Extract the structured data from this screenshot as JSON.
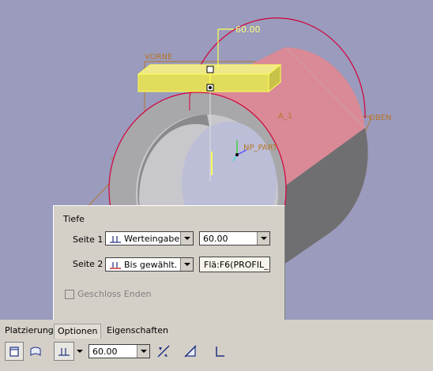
{
  "viewport": {
    "labels": {
      "front_plane": "VORNE",
      "top_plane": "OBEN",
      "axis": "A_1",
      "csys": "NP_PART"
    },
    "dimension_value": "60.00",
    "colors": {
      "background": "#9a9bbd",
      "cylinder": "#d98a96",
      "preview_feature": "#e2dc5c",
      "datum": "#b8752a"
    }
  },
  "options_panel": {
    "title": "Tiefe",
    "side1": {
      "label": "Seite 1",
      "type_icon": "blind-depth-icon",
      "type_value": "Werteingabe",
      "depth_value": "60.00"
    },
    "side2": {
      "label": "Seite 2",
      "type_icon": "up-to-selected-icon",
      "type_value": "Bis gewählt.",
      "reference_value": "Flä:F6(PROFIL_"
    },
    "capped_ends": {
      "label": "Geschloss Enden",
      "checked": false,
      "enabled": false
    }
  },
  "dashboard": {
    "tabs": [
      "Platzierung",
      "Optionen",
      "Eigenschaften"
    ],
    "active_tab": "Optionen",
    "depth_value": "60.00",
    "icons": [
      "solid-icon",
      "surface-icon",
      "blind-depth-icon",
      "flip-direction-icon",
      "remove-material-icon",
      "thicken-icon"
    ]
  }
}
